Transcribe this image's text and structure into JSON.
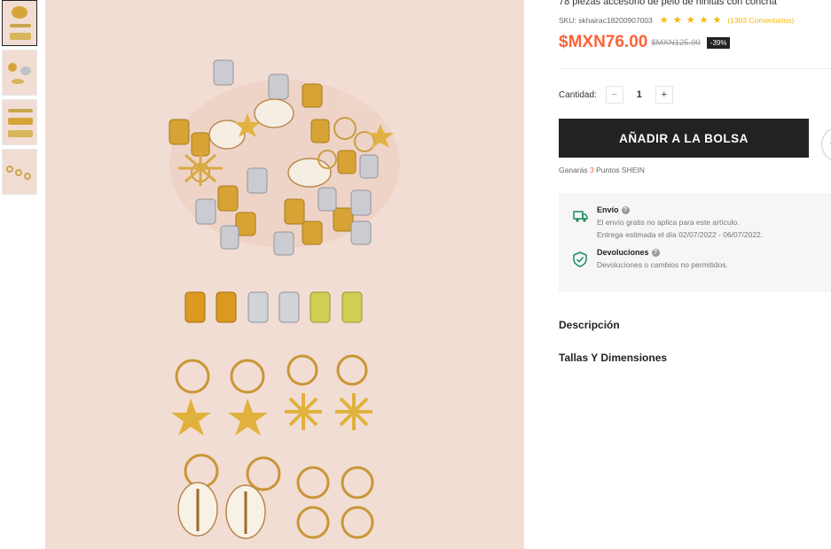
{
  "product": {
    "title": "78 piezas accesorio de pelo de niñitas con concha",
    "sku": "SKU: skhairac18200907003",
    "stars": "★ ★ ★ ★ ★",
    "reviews": "(1303 Comentarios)",
    "price": "$MXN76.00",
    "old_price": "$MXN125.00",
    "discount": "-39%"
  },
  "quantity": {
    "label": "Cantidad:",
    "minus": "−",
    "value": "1",
    "plus": "+"
  },
  "add_to_bag": "AÑADIR A LA BOLSA",
  "wishlist_icon": "chevron-left-icon",
  "points": {
    "prefix": "Ganarás",
    "value": "3",
    "suffix": "Puntos SHEIN"
  },
  "shipping": {
    "title": "Envío",
    "line1": "El envío gratis no aplica para este artículo.",
    "line2": "Entrega estimada el día 02/07/2022 - 06/07/2022."
  },
  "returns": {
    "title": "Devoluciones",
    "line1": "Devoluciones o cambios no permitidos."
  },
  "help_glyph": "?",
  "sections": {
    "description": "Descripción",
    "sizes": "Tallas Y Dimensiones"
  },
  "colors": {
    "price": "#fa6338",
    "button": "#222222",
    "stars": "#f5b800",
    "accent_icon": "#1b8c5b",
    "image_bg": "#f2ddd4"
  }
}
